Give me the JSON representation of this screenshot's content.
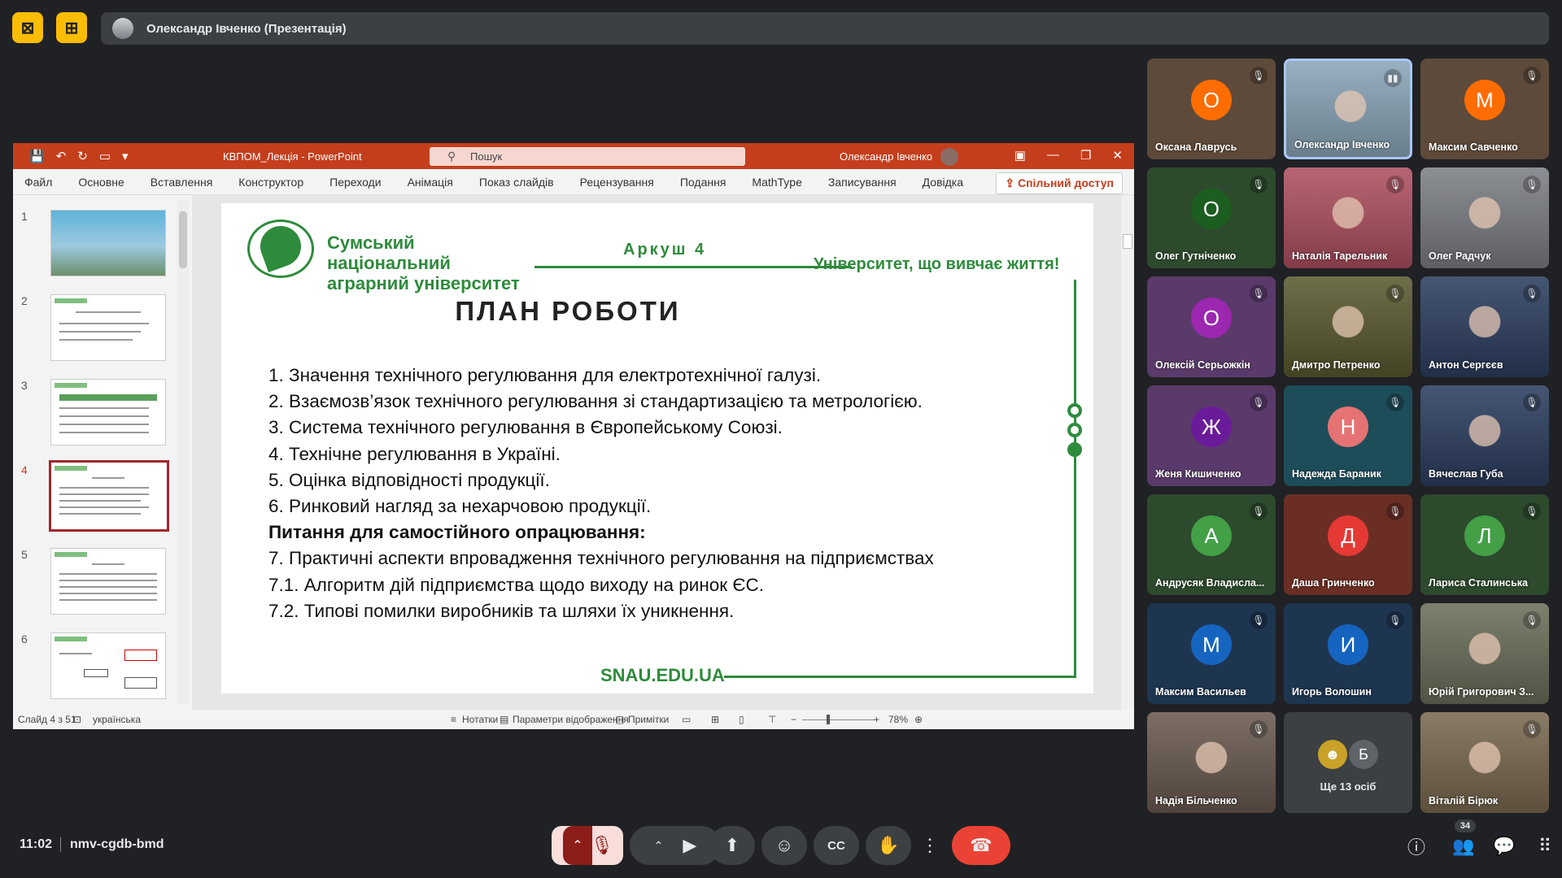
{
  "presenter_bar": {
    "name": "Олександр Івченко (Презентація)"
  },
  "ppt": {
    "doc_title": "КВПОМ_Лекція  -  PowerPoint",
    "search_placeholder": "Пошук",
    "user": "Олександр Івченко",
    "ribbon_tabs": [
      "Файл",
      "Основне",
      "Вставлення",
      "Конструктор",
      "Переходи",
      "Анімація",
      "Показ слайдів",
      "Рецензування",
      "Подання",
      "MathType",
      "Записування",
      "Довідка"
    ],
    "share": "Спільний доступ",
    "thumb_numbers": [
      "1",
      "2",
      "3",
      "4",
      "5",
      "6"
    ],
    "active_slide": 4,
    "status": {
      "slide": "Слайд 4 з 51",
      "lang": "українська",
      "notes": "Нотатки",
      "display": "Параметри відображення",
      "comments": "Примітки",
      "zoom": "78%"
    }
  },
  "slide": {
    "uni_name_1": "Сумський національний",
    "uni_name_2": "аграрний університет",
    "sheet": "Аркуш 4",
    "motto": "Університет, що вивчає життя!",
    "title": "ПЛАН РОБОТИ",
    "items": [
      "1. Значення технічного регулювання для електротехнічної галузі.",
      "2. Взаємозв’язок технічного регулювання зі стандартизацією та метрологією.",
      "3. Система технічного регулювання в Європейському Союзі.",
      "4. Технічне регулювання в Україні.",
      "5. Оцінка відповідності продукції.",
      "6. Ринковий нагляд за нехарчовою продукції."
    ],
    "self_study": "Питання для самостійного опрацювання:",
    "items2": [
      "7. Практичні аспекти впровадження технічного регулювання на підприємствах",
      "7.1. Алгоритм дій підприємства щодо виходу на ринок ЄС.",
      "7.2. Типові помилки виробників та шляхи їх уникнення."
    ],
    "site": "SNAU.EDU.UA"
  },
  "participants": [
    {
      "name": "Оксана Лаврусь",
      "initial": "О",
      "color": "#ff6d00",
      "bg": "#5e4a3a"
    },
    {
      "name": "Олександр Івченко",
      "initial": "",
      "color": "",
      "bg": "#8aa5b8",
      "speaking": true
    },
    {
      "name": "Максим Савченко",
      "initial": "М",
      "color": "#ff6d00",
      "bg": "#5e4a3a"
    },
    {
      "name": "Олег Гутніченко",
      "initial": "О",
      "color": "#1b5e20",
      "bg": "#2d4a2d"
    },
    {
      "name": "Наталія Тарельник",
      "initial": "",
      "color": "",
      "bg": "#b05060"
    },
    {
      "name": "Олег Радчук",
      "initial": "",
      "color": "",
      "bg": "#7c7f85"
    },
    {
      "name": "Олексій Серьожкін",
      "initial": "О",
      "color": "#9c27b0",
      "bg": "#5a3a6a"
    },
    {
      "name": "Дмитро Петренко",
      "initial": "",
      "color": "",
      "bg": "#5a5a30"
    },
    {
      "name": "Антон Сергєєв",
      "initial": "",
      "color": "",
      "bg": "#2c3e60"
    },
    {
      "name": "Женя Кишиченко",
      "initial": "Ж",
      "color": "#6a1b9a",
      "bg": "#5a3a6a"
    },
    {
      "name": "Надежда Бараник",
      "initial": "Н",
      "color": "#e57373",
      "bg": "#1e4d5a"
    },
    {
      "name": "Вячеслав Губа",
      "initial": "",
      "color": "",
      "bg": "#2c3e60"
    },
    {
      "name": "Андрусяк Владисла...",
      "initial": "А",
      "color": "#43a047",
      "bg": "#2d4a2d"
    },
    {
      "name": "Даша Гринченко",
      "initial": "Д",
      "color": "#e53935",
      "bg": "#6a2e24"
    },
    {
      "name": "Лариса Сталинська",
      "initial": "Л",
      "color": "#43a047",
      "bg": "#2d4a2d"
    },
    {
      "name": "Максим Васильев",
      "initial": "М",
      "color": "#1565c0",
      "bg": "#1e3550"
    },
    {
      "name": "Игорь Волошин",
      "initial": "И",
      "color": "#1565c0",
      "bg": "#1e3550"
    },
    {
      "name": "Юрій Григорович З...",
      "initial": "",
      "color": "",
      "bg": "#6b6f5a"
    },
    {
      "name": "Надія Більченко",
      "initial": "",
      "color": "",
      "bg": "#6a5a50"
    },
    {
      "name": "",
      "initial": "",
      "color": "",
      "bg": "#3c4043",
      "more": "Ще 13 осіб"
    },
    {
      "name": "Віталій Бірюк",
      "initial": "",
      "color": "",
      "bg": "#7a6a50"
    }
  ],
  "more_tile": {
    "label": "Ще 13 осіб",
    "letter": "Б"
  },
  "bottom": {
    "time": "11:02",
    "code": "nmv-cgdb-bmd",
    "people_count": "34"
  },
  "icons": {
    "present-off": "⛶",
    "mic-off": "🎙",
    "camera": "📹",
    "present": "⬆",
    "emoji": "☺",
    "captions": "CC",
    "hand": "✋",
    "more": "⋮",
    "hangup": "☎",
    "info": "ⓘ",
    "people": "👥",
    "chat": "💬",
    "activities": "⠿"
  }
}
